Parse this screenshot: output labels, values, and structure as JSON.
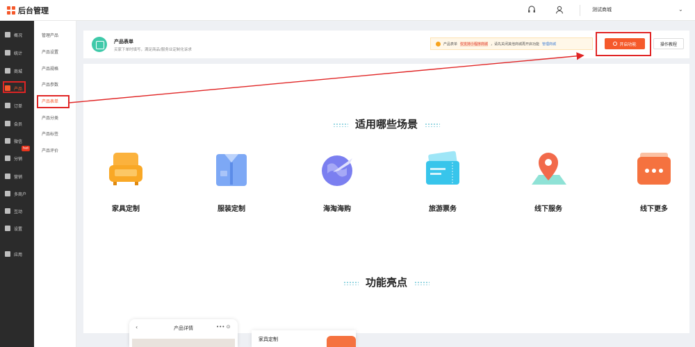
{
  "topbar": {
    "app_title": "后台管理",
    "store_name": "测试商城",
    "icons": [
      "headset-icon",
      "user-icon",
      "chevron-down-icon"
    ]
  },
  "sidebar": {
    "items": [
      {
        "label": "概况",
        "icon": "layers-icon"
      },
      {
        "label": "统计",
        "icon": "bar-chart-icon"
      },
      {
        "label": "商城",
        "icon": "store-icon"
      },
      {
        "label": "产品",
        "icon": "grid-icon",
        "active": true
      },
      {
        "label": "订单",
        "icon": "order-icon"
      },
      {
        "label": "会员",
        "icon": "crown-icon"
      },
      {
        "label": "微信",
        "icon": "wechat-icon"
      },
      {
        "label": "分销",
        "icon": "share-icon"
      },
      {
        "label": "营销",
        "icon": "flag-icon"
      },
      {
        "label": "多商户",
        "icon": "shop-icon"
      },
      {
        "label": "互动",
        "icon": "interact-icon"
      },
      {
        "label": "设置",
        "icon": "gear-icon"
      },
      {
        "label": "应用",
        "icon": "apps-icon"
      }
    ],
    "hot_badge": "hot"
  },
  "subnav": {
    "items": [
      "管理产品",
      "产品设置",
      "产品规格",
      "产品参数",
      "产品表单",
      "产品分类",
      "产品标签",
      "产品评价"
    ],
    "active_index": 4
  },
  "header": {
    "title": "产品表单",
    "description": "买家下单时填写，满足商品/服务业定制化诉求",
    "notice_prefix": "产品表单",
    "notice_highlight": "仅支持小程序商城",
    "notice_middle": "，请先关闭其他商城再开启功能",
    "notice_link": "管理商城",
    "open_button": "开启功能",
    "tutorial_button": "操作教程"
  },
  "scenes": {
    "title": "适用哪些场景",
    "items": [
      {
        "label": "家具定制",
        "icon": "sofa-icon"
      },
      {
        "label": "服装定制",
        "icon": "shirt-icon"
      },
      {
        "label": "海淘海购",
        "icon": "globe-plane-icon"
      },
      {
        "label": "旅游票务",
        "icon": "ticket-icon"
      },
      {
        "label": "线下服务",
        "icon": "map-pin-icon"
      },
      {
        "label": "线下更多",
        "icon": "more-chat-icon"
      }
    ]
  },
  "highlights": {
    "title": "功能亮点",
    "phone_title": "产品详情",
    "furniture_label": "家具定制"
  },
  "colors": {
    "accent": "#f5592b",
    "sidebar_bg": "#2b2b2b",
    "annotation_red": "#e02424",
    "teal": "#3fc9a9"
  }
}
